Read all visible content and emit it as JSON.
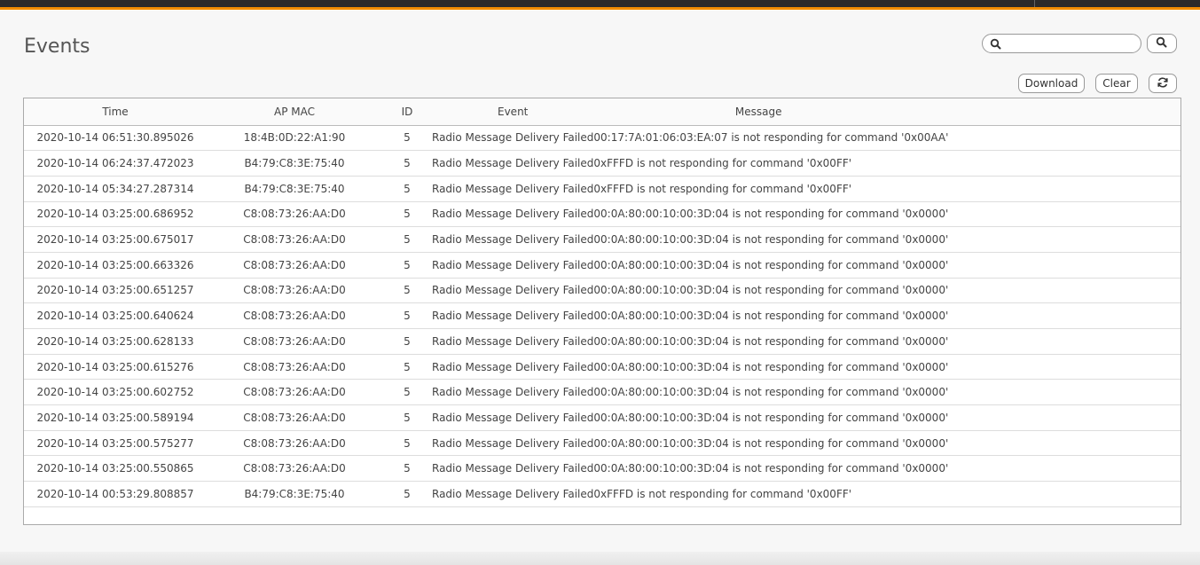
{
  "page": {
    "title": "Events"
  },
  "search": {
    "value": "",
    "placeholder": ""
  },
  "icons": {
    "search": "search-icon",
    "refresh": "refresh-icon"
  },
  "toolbar": {
    "download_label": "Download",
    "clear_label": "Clear"
  },
  "colors": {
    "accent": "#f08c00",
    "topbar": "#2a2a2a"
  },
  "table": {
    "columns": [
      "Time",
      "AP MAC",
      "ID",
      "Event",
      "Message"
    ],
    "rows": [
      [
        "2020-10-14 06:51:30.895026",
        "18:4B:0D:22:A1:90",
        "5",
        "Radio Message Delivery Failed",
        "00:17:7A:01:06:03:EA:07 is not responding for command '0x00AA'"
      ],
      [
        "2020-10-14 06:24:37.472023",
        "B4:79:C8:3E:75:40",
        "5",
        "Radio Message Delivery Failed",
        "0xFFFD is not responding for command '0x00FF'"
      ],
      [
        "2020-10-14 05:34:27.287314",
        "B4:79:C8:3E:75:40",
        "5",
        "Radio Message Delivery Failed",
        "0xFFFD is not responding for command '0x00FF'"
      ],
      [
        "2020-10-14 03:25:00.686952",
        "C8:08:73:26:AA:D0",
        "5",
        "Radio Message Delivery Failed",
        "00:0A:80:00:10:00:3D:04 is not responding for command '0x0000'"
      ],
      [
        "2020-10-14 03:25:00.675017",
        "C8:08:73:26:AA:D0",
        "5",
        "Radio Message Delivery Failed",
        "00:0A:80:00:10:00:3D:04 is not responding for command '0x0000'"
      ],
      [
        "2020-10-14 03:25:00.663326",
        "C8:08:73:26:AA:D0",
        "5",
        "Radio Message Delivery Failed",
        "00:0A:80:00:10:00:3D:04 is not responding for command '0x0000'"
      ],
      [
        "2020-10-14 03:25:00.651257",
        "C8:08:73:26:AA:D0",
        "5",
        "Radio Message Delivery Failed",
        "00:0A:80:00:10:00:3D:04 is not responding for command '0x0000'"
      ],
      [
        "2020-10-14 03:25:00.640624",
        "C8:08:73:26:AA:D0",
        "5",
        "Radio Message Delivery Failed",
        "00:0A:80:00:10:00:3D:04 is not responding for command '0x0000'"
      ],
      [
        "2020-10-14 03:25:00.628133",
        "C8:08:73:26:AA:D0",
        "5",
        "Radio Message Delivery Failed",
        "00:0A:80:00:10:00:3D:04 is not responding for command '0x0000'"
      ],
      [
        "2020-10-14 03:25:00.615276",
        "C8:08:73:26:AA:D0",
        "5",
        "Radio Message Delivery Failed",
        "00:0A:80:00:10:00:3D:04 is not responding for command '0x0000'"
      ],
      [
        "2020-10-14 03:25:00.602752",
        "C8:08:73:26:AA:D0",
        "5",
        "Radio Message Delivery Failed",
        "00:0A:80:00:10:00:3D:04 is not responding for command '0x0000'"
      ],
      [
        "2020-10-14 03:25:00.589194",
        "C8:08:73:26:AA:D0",
        "5",
        "Radio Message Delivery Failed",
        "00:0A:80:00:10:00:3D:04 is not responding for command '0x0000'"
      ],
      [
        "2020-10-14 03:25:00.575277",
        "C8:08:73:26:AA:D0",
        "5",
        "Radio Message Delivery Failed",
        "00:0A:80:00:10:00:3D:04 is not responding for command '0x0000'"
      ],
      [
        "2020-10-14 03:25:00.550865",
        "C8:08:73:26:AA:D0",
        "5",
        "Radio Message Delivery Failed",
        "00:0A:80:00:10:00:3D:04 is not responding for command '0x0000'"
      ],
      [
        "2020-10-14 00:53:29.808857",
        "B4:79:C8:3E:75:40",
        "5",
        "Radio Message Delivery Failed",
        "0xFFFD is not responding for command '0x00FF'"
      ]
    ]
  }
}
